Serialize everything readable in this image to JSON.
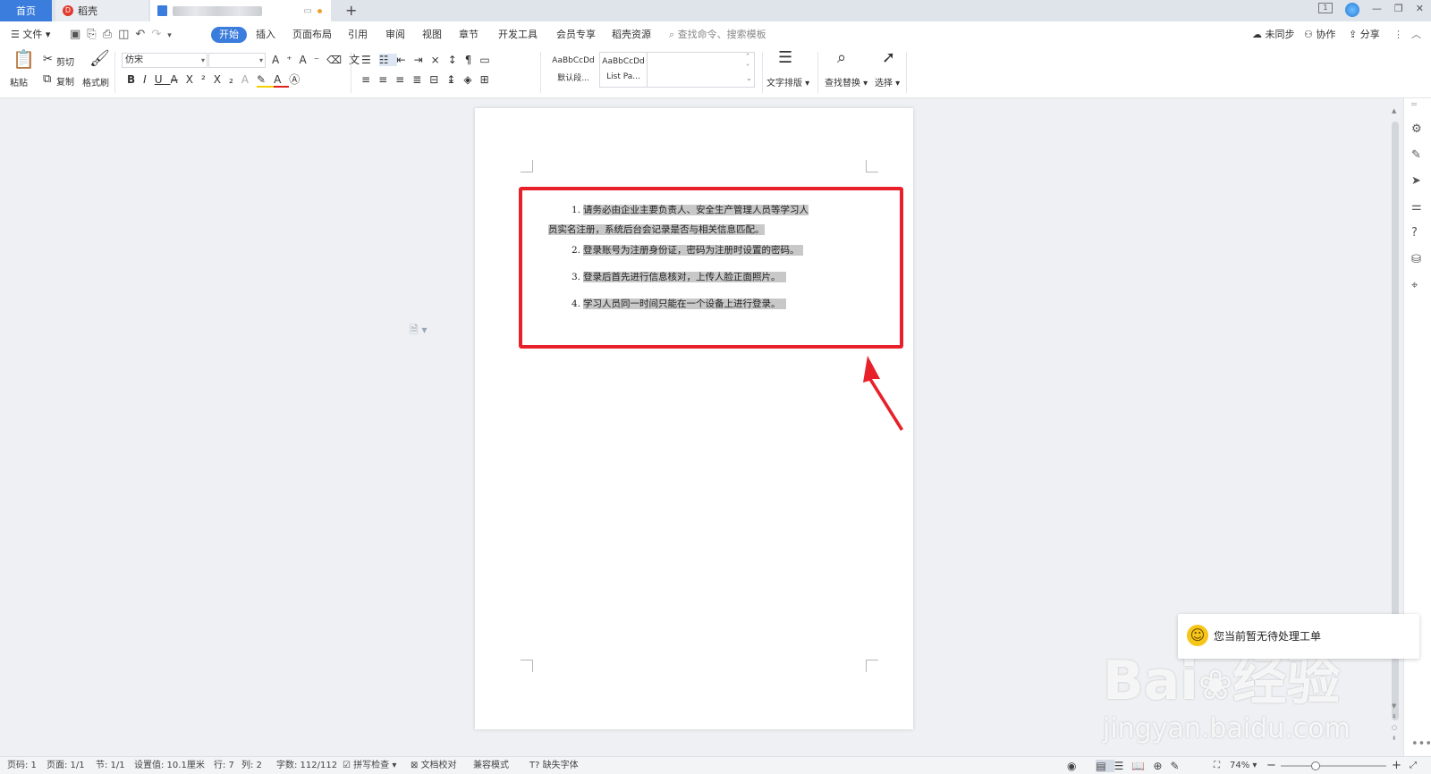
{
  "tabs": {
    "home": "首页",
    "daoke": "稻壳",
    "new_tab": "+"
  },
  "menu": {
    "file": "文件",
    "items": [
      "开始",
      "插入",
      "页面布局",
      "引用",
      "审阅",
      "视图",
      "章节",
      "开发工具",
      "会员专享",
      "稻壳资源"
    ],
    "search_placeholder": "查找命令、搜索模板",
    "right": [
      "未同步",
      "协作",
      "分享"
    ]
  },
  "ribbon": {
    "paste": "粘贴",
    "cut": "剪切",
    "copy": "复制",
    "format_painter": "格式刷",
    "font_name": "仿宋",
    "font_size": "",
    "style1_sample": "AaBbCcDd",
    "style1_name": "默认段...",
    "style2_sample": "AaBbCcDd",
    "style2_name": "List Pa...",
    "text_layout": "文字排版",
    "find_replace": "查找替换",
    "select": "选择"
  },
  "document": {
    "items": [
      {
        "num": "1.",
        "line1": "请务必由企业主要负责人、安全生产管理人员等学习人",
        "line2": "员实名注册，系统后台会记录是否与相关信息匹配。"
      },
      {
        "num": "2.",
        "line1": "登录账号为注册身份证，密码为注册时设置的密码。"
      },
      {
        "num": "3.",
        "line1": "登录后首先进行信息核对，上传人脸正面照片。"
      },
      {
        "num": "4.",
        "line1": "学习人员同一时间只能在一个设备上进行登录。"
      }
    ]
  },
  "popup": {
    "text": "您当前暂无待处理工单"
  },
  "status": {
    "page_code": "页码: 1",
    "pages": "页面: 1/1",
    "section": "节: 1/1",
    "setting": "设置值: 10.1厘米",
    "row": "行: 7",
    "col": "列: 2",
    "words": "字数: 112/112",
    "spell": "拼写检查",
    "proof": "文档校对",
    "compat": "兼容模式",
    "missing_font": "缺失字体",
    "zoom": "74%"
  },
  "watermark": {
    "brand": "Bai",
    "brand2": "经验",
    "url": "jingyan.baidu.com"
  },
  "colors": {
    "accent": "#3b7ddd",
    "annotation": "#e8202a"
  }
}
